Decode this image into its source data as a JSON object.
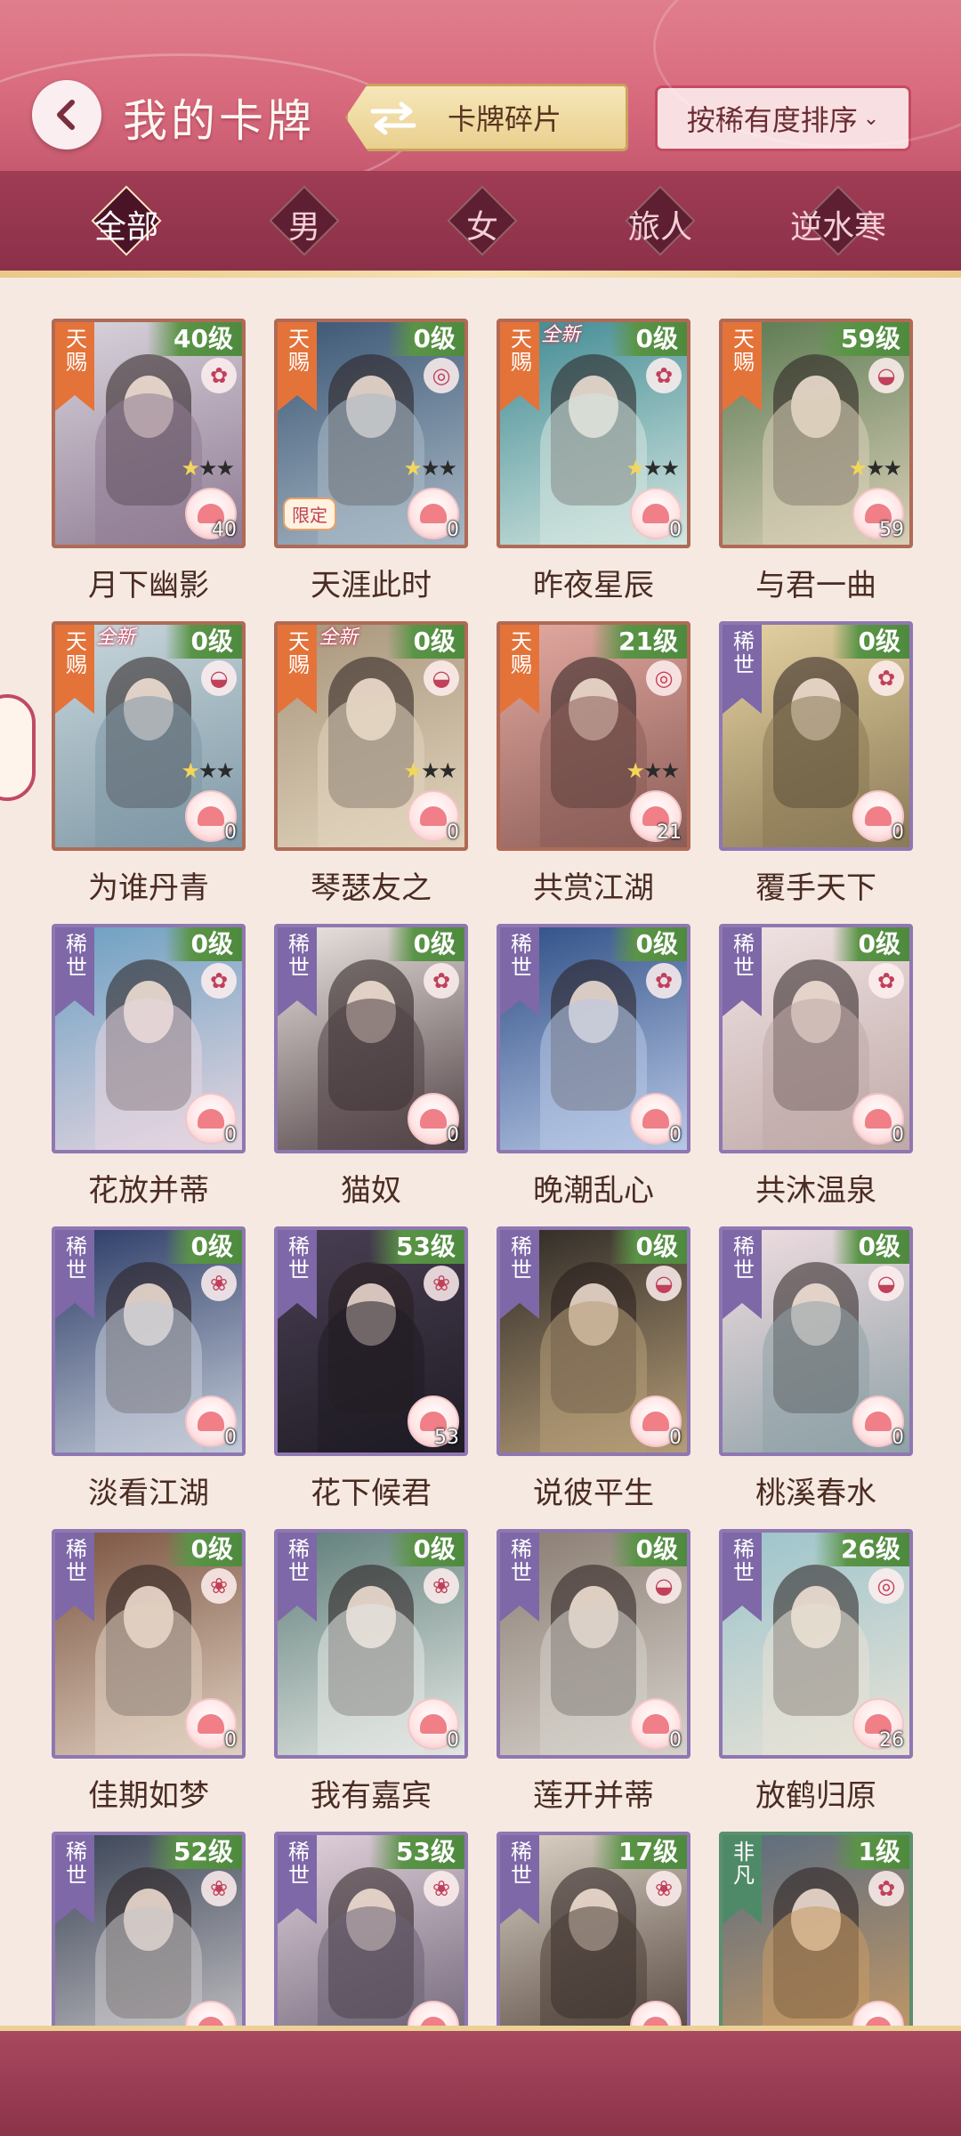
{
  "header": {
    "title": "我的卡牌",
    "fragments_label": "卡牌碎片",
    "sort_label": "按稀有度排序"
  },
  "tabs": [
    {
      "label": "全部",
      "active": true
    },
    {
      "label": "男",
      "active": false
    },
    {
      "label": "女",
      "active": false
    },
    {
      "label": "旅人",
      "active": false
    },
    {
      "label": "逆水寒",
      "active": false
    }
  ],
  "cards": [
    {
      "name": "月下幽影",
      "rarity": "天赐",
      "level": "40级",
      "count": "40",
      "new_tag": "",
      "limited_tag": "",
      "palette": [
        "#d9d4dc",
        "#8f7b93"
      ],
      "emblem": "flower-icon"
    },
    {
      "name": "天涯此时",
      "rarity": "天赐",
      "level": "0级",
      "count": "0",
      "new_tag": "",
      "limited_tag": "限定",
      "palette": [
        "#3b5674",
        "#a9b9c6"
      ],
      "emblem": "coin-icon"
    },
    {
      "name": "昨夜星辰",
      "rarity": "天赐",
      "level": "0级",
      "count": "0",
      "new_tag": "全新",
      "limited_tag": "",
      "palette": [
        "#3f8a93",
        "#d4e6e0"
      ],
      "emblem": "flower-icon"
    },
    {
      "name": "与君一曲",
      "rarity": "天赐",
      "level": "59级",
      "count": "59",
      "new_tag": "",
      "limited_tag": "",
      "palette": [
        "#5b7a52",
        "#d9cfb7"
      ],
      "emblem": "fan-icon"
    },
    {
      "name": "为谁丹青",
      "rarity": "天赐",
      "level": "0级",
      "count": "0",
      "new_tag": "全新",
      "limited_tag": "",
      "palette": [
        "#c9d7dc",
        "#7f98a6"
      ],
      "emblem": "fan-icon"
    },
    {
      "name": "琴瑟友之",
      "rarity": "天赐",
      "level": "0级",
      "count": "0",
      "new_tag": "全新",
      "limited_tag": "",
      "palette": [
        "#a8957c",
        "#e2d4bd"
      ],
      "emblem": "fan-icon"
    },
    {
      "name": "共赏江湖",
      "rarity": "天赐",
      "level": "21级",
      "count": "21",
      "new_tag": "",
      "limited_tag": "",
      "palette": [
        "#e3a9a0",
        "#8b5d57"
      ],
      "emblem": "coin-icon"
    },
    {
      "name": "覆手天下",
      "rarity": "稀世",
      "level": "0级",
      "count": "0",
      "new_tag": "",
      "limited_tag": "",
      "palette": [
        "#e6d2a2",
        "#8a7a56"
      ],
      "emblem": "flower-icon"
    },
    {
      "name": "花放并蒂",
      "rarity": "稀世",
      "level": "0级",
      "count": "0",
      "new_tag": "",
      "limited_tag": "",
      "palette": [
        "#6c9fc2",
        "#e5d6e0"
      ],
      "emblem": "flower-icon"
    },
    {
      "name": "猫奴",
      "rarity": "稀世",
      "level": "0级",
      "count": "0",
      "new_tag": "",
      "limited_tag": "",
      "palette": [
        "#ece6e2",
        "#514246"
      ],
      "emblem": "flower-icon"
    },
    {
      "name": "晚潮乱心",
      "rarity": "稀世",
      "level": "0级",
      "count": "0",
      "new_tag": "",
      "limited_tag": "",
      "palette": [
        "#2f4f86",
        "#b8c8e6"
      ],
      "emblem": "flower-icon"
    },
    {
      "name": "共沐温泉",
      "rarity": "稀世",
      "level": "0级",
      "count": "0",
      "new_tag": "",
      "limited_tag": "",
      "palette": [
        "#f1e3e4",
        "#bfaaa8"
      ],
      "emblem": "flower-icon"
    },
    {
      "name": "淡看江湖",
      "rarity": "稀世",
      "level": "0级",
      "count": "0",
      "new_tag": "",
      "limited_tag": "",
      "palette": [
        "#2b3b66",
        "#c4ccd9"
      ],
      "emblem": "jade-icon"
    },
    {
      "name": "花下候君",
      "rarity": "稀世",
      "level": "53级",
      "count": "53",
      "new_tag": "",
      "limited_tag": "",
      "palette": [
        "#4a3f54",
        "#1f1c24"
      ],
      "emblem": "jade-icon"
    },
    {
      "name": "说彼平生",
      "rarity": "稀世",
      "level": "0级",
      "count": "0",
      "new_tag": "",
      "limited_tag": "",
      "palette": [
        "#2e2a26",
        "#b59c77"
      ],
      "emblem": "fan-icon"
    },
    {
      "name": "桃溪春水",
      "rarity": "稀世",
      "level": "0级",
      "count": "0",
      "new_tag": "",
      "limited_tag": "",
      "palette": [
        "#f0dde1",
        "#8fa2a7"
      ],
      "emblem": "fan-icon"
    },
    {
      "name": "佳期如梦",
      "rarity": "稀世",
      "level": "0级",
      "count": "0",
      "new_tag": "",
      "limited_tag": "",
      "palette": [
        "#7b5440",
        "#e0cfc0"
      ],
      "emblem": "jade-icon"
    },
    {
      "name": "我有嘉宾",
      "rarity": "稀世",
      "level": "0级",
      "count": "0",
      "new_tag": "",
      "limited_tag": "",
      "palette": [
        "#5f7e7a",
        "#e3e7e3"
      ],
      "emblem": "jade-icon"
    },
    {
      "name": "莲开并蒂",
      "rarity": "稀世",
      "level": "0级",
      "count": "0",
      "new_tag": "",
      "limited_tag": "",
      "palette": [
        "#8a7d72",
        "#d6d1cb"
      ],
      "emblem": "fan-icon"
    },
    {
      "name": "放鹤归原",
      "rarity": "稀世",
      "level": "26级",
      "count": "26",
      "new_tag": "",
      "limited_tag": "",
      "palette": [
        "#9bc4cc",
        "#e8e2d6"
      ],
      "emblem": "coin-icon"
    },
    {
      "name": "",
      "rarity": "稀世",
      "level": "52级",
      "count": "",
      "new_tag": "",
      "limited_tag": "",
      "palette": [
        "#3a4456",
        "#c9c6c9"
      ],
      "emblem": "jade-icon"
    },
    {
      "name": "",
      "rarity": "稀世",
      "level": "53级",
      "count": "",
      "new_tag": "",
      "limited_tag": "",
      "palette": [
        "#e2d2dc",
        "#6c6275"
      ],
      "emblem": "jade-icon"
    },
    {
      "name": "",
      "rarity": "稀世",
      "level": "17级",
      "count": "",
      "new_tag": "",
      "limited_tag": "",
      "palette": [
        "#ddd3c6",
        "#4d4038"
      ],
      "emblem": "jade-icon"
    },
    {
      "name": "",
      "rarity": "非凡",
      "level": "1级",
      "count": "",
      "new_tag": "",
      "limited_tag": "",
      "palette": [
        "#5a6c80",
        "#c89a64"
      ],
      "emblem": "flower-icon"
    }
  ],
  "colors": {
    "header_pink": "#d96b7e",
    "filter_bar": "#8c3049",
    "rarity_tianci": "#e4733a",
    "rarity_xishi": "#7e68a8",
    "rarity_feifan": "#4f8a68",
    "level_green": "#5a9446"
  }
}
